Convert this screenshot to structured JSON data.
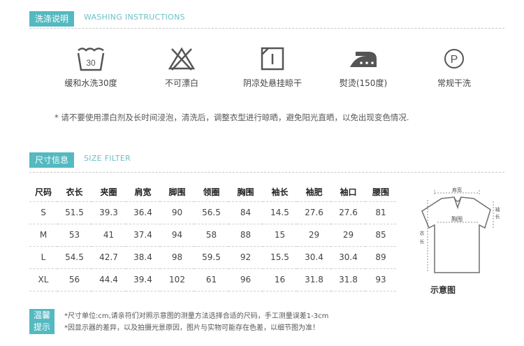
{
  "washing": {
    "tag": "洗涤说明",
    "subtitle": "WASHING INSTRUCTIONS",
    "icons": [
      {
        "icon": "wash-30-icon",
        "label": "缓和水洗30度",
        "temp": "30"
      },
      {
        "icon": "no-bleach-icon",
        "label": "不可漂白"
      },
      {
        "icon": "hang-dry-shade-icon",
        "label": "阴凉处悬挂晾干"
      },
      {
        "icon": "iron-150-icon",
        "label": "熨烫(150度)"
      },
      {
        "icon": "dry-clean-icon",
        "label": "常规干洗",
        "letter": "P"
      }
    ],
    "notice": "* 请不要使用漂白剂及长时间浸泡，清洗后，调整衣型进行晾晒，避免阳光直晒，以免出现变色情况."
  },
  "size": {
    "tag": "尺寸信息",
    "subtitle": "SIZE FILTER",
    "headers": [
      "尺码",
      "衣长",
      "夹圈",
      "肩宽",
      "脚围",
      "领圈",
      "胸围",
      "袖长",
      "袖肥",
      "袖口",
      "腰围"
    ],
    "rows": [
      [
        "S",
        "51.5",
        "39.3",
        "36.4",
        "90",
        "56.5",
        "84",
        "14.5",
        "27.6",
        "27.6",
        "81"
      ],
      [
        "M",
        "53",
        "41",
        "37.4",
        "94",
        "58",
        "88",
        "15",
        "29",
        "29",
        "85"
      ],
      [
        "L",
        "54.5",
        "42.7",
        "38.4",
        "98",
        "59.5",
        "92",
        "15.5",
        "30.4",
        "30.4",
        "89"
      ],
      [
        "XL",
        "56",
        "44.4",
        "39.4",
        "102",
        "61",
        "96",
        "16",
        "31.8",
        "31.8",
        "93"
      ]
    ]
  },
  "diagram": {
    "shoulder": "肩宽",
    "chest": "胸围",
    "sleeve_v1": "袖",
    "sleeve_v2": "长",
    "length_v1": "衣",
    "length_v2": "长",
    "caption": "示意图"
  },
  "tips": {
    "tag_line1": "温馨",
    "tag_line2": "提示",
    "line1": "*尺寸单位:cm,请亲符们对照示意图的测量方法选择合适的尺码，手工测量误差1-3cm",
    "line2": "*因显示器的差异，以及拍摄光景原因，图片与实物可能存在色差，以细节图为准！"
  },
  "colors": {
    "accent": "#54b9c0",
    "icon": "#555555"
  }
}
